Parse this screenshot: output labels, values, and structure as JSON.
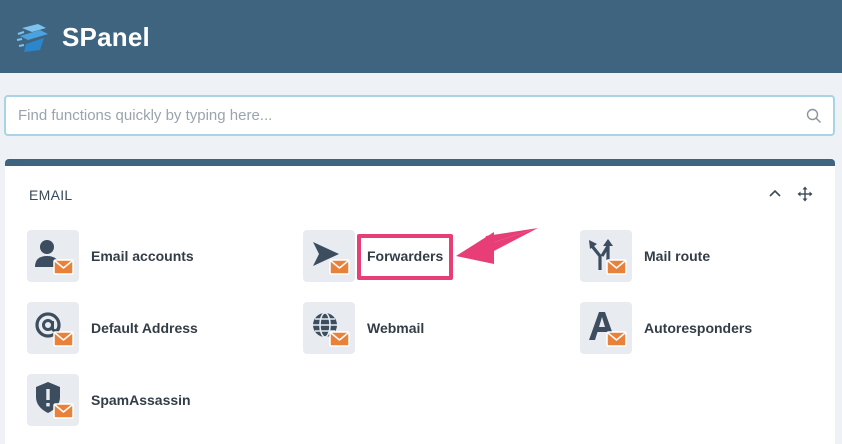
{
  "app": {
    "brand": "SPanel"
  },
  "search": {
    "placeholder": "Find functions quickly by typing here..."
  },
  "panel": {
    "title": "EMAIL",
    "items": [
      {
        "label": "Email accounts",
        "icon": "user-mail-icon"
      },
      {
        "label": "Forwarders",
        "icon": "send-mail-icon"
      },
      {
        "label": "Mail route",
        "icon": "route-mail-icon"
      },
      {
        "label": "Default Address",
        "icon": "at-mail-icon"
      },
      {
        "label": "Webmail",
        "icon": "globe-mail-icon"
      },
      {
        "label": "Autoresponders",
        "icon": "a-mail-icon"
      },
      {
        "label": "SpamAssassin",
        "icon": "shield-mail-icon"
      }
    ]
  },
  "colors": {
    "header": "#3e6480",
    "icon": "#3b4d5e",
    "envelope": "#e8813a",
    "highlight": "#e83e78"
  }
}
